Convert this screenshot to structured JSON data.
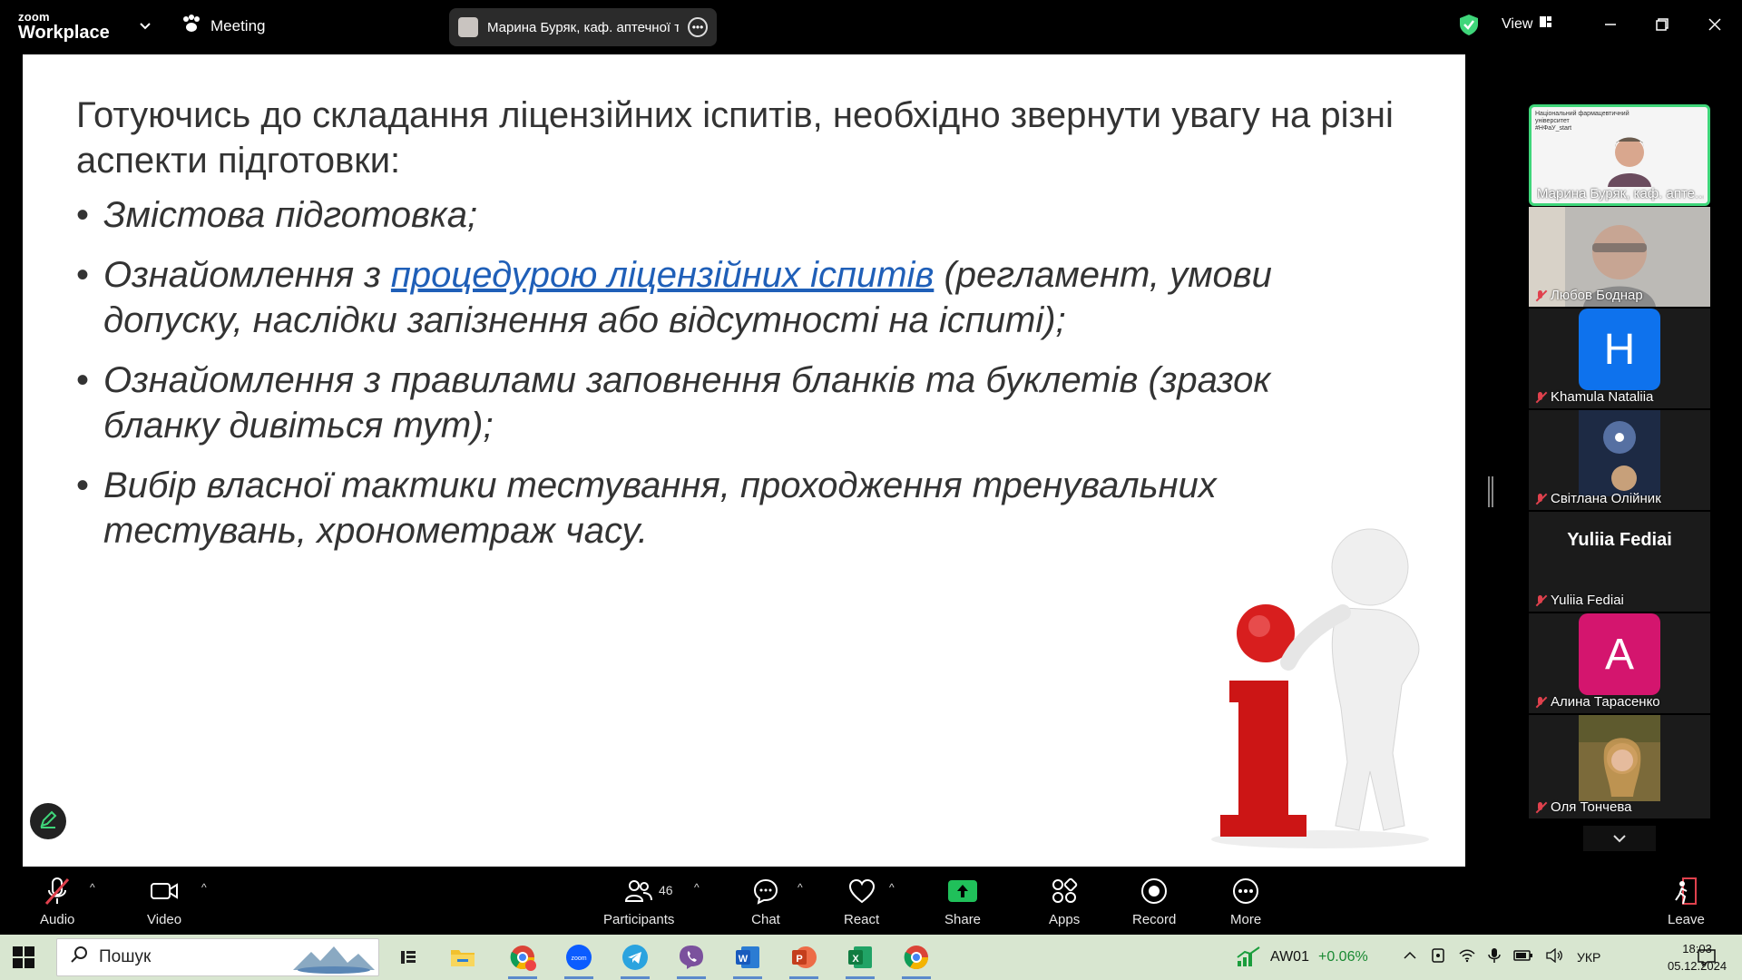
{
  "topbar": {
    "logo_line1": "zoom",
    "logo_line2": "Workplace",
    "meeting_label": "Meeting",
    "active_speaker": "Марина Буряк, каф. аптечної те",
    "view_label": "View",
    "security_color": "#3fd67a"
  },
  "slide": {
    "intro": "Готуючись до складання ліцензійних іспитів, необхідно звернути увагу на різні аспекти підготовки:",
    "bullet1": "Змістова підготовка;",
    "bullet2_pre": "Ознайомлення з ",
    "bullet2_link": "процедурою ліцензійних іспитів",
    "bullet2_post": " (регламент, умови допуску, наслідки запізнення або відсутності на іспиті);",
    "bullet3": "Ознайомлення з правилами заповнення бланків та буклетів (зразок бланку дивіться тут);",
    "bullet4": "Вибір власної тактики тестування, проходження тренувальних тестувань, хронометраж часу.",
    "link_color": "#1f5fb8"
  },
  "participants_panel": {
    "tiles": [
      {
        "name": "Марина Буряк, каф. апте...",
        "type": "video",
        "active": true,
        "header_text": "Національний фармацевтичний університет",
        "header_sub": "#НФаУ_start"
      },
      {
        "name": "Любов Боднар",
        "type": "video",
        "muted": true
      },
      {
        "name": "Khamula Nataliia",
        "type": "avatar",
        "letter": "H",
        "color": "#0e72ed",
        "muted": true
      },
      {
        "name": "Світлана Олійник",
        "type": "photo",
        "muted": true
      },
      {
        "name": "Yuliia Fediai",
        "type": "name",
        "muted": true
      },
      {
        "name": "Алина Тарасенко",
        "type": "avatar",
        "letter": "A",
        "color": "#d4156e",
        "muted": true
      },
      {
        "name": "Оля Тончева",
        "type": "photo",
        "muted": true
      }
    ]
  },
  "toolbar": {
    "audio": "Audio",
    "video": "Video",
    "participants": "Participants",
    "participants_count": "46",
    "chat": "Chat",
    "react": "React",
    "share": "Share",
    "apps": "Apps",
    "record": "Record",
    "more": "More",
    "leave": "Leave",
    "share_color": "#20c05a",
    "leave_color": "#e0414d"
  },
  "taskbar": {
    "search_label": "Пошук",
    "stock_name": "AW01",
    "stock_change": "+0.06%",
    "language": "УКР",
    "time": "18:03",
    "date": "05.12.2024",
    "apps": [
      "task-view",
      "file-explorer",
      "chrome-profile",
      "zoom",
      "telegram",
      "viber",
      "word",
      "powerpoint",
      "excel",
      "chrome"
    ]
  }
}
